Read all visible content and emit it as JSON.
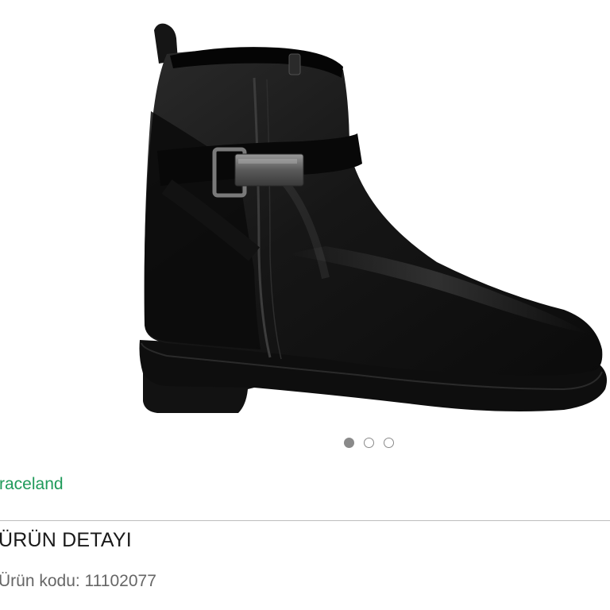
{
  "product": {
    "image_alt": "black ankle boot with buckle strap",
    "brand": "raceland",
    "section_heading": "ÜRÜN DETAYI",
    "code_line": "Ürün kodu: 11102077"
  },
  "carousel": {
    "total_slides": 3,
    "active_index": 0
  },
  "colors": {
    "brand_link": "#1f9a5a",
    "dot_active": "#8a8a8a",
    "divider": "#bdbdbd"
  }
}
